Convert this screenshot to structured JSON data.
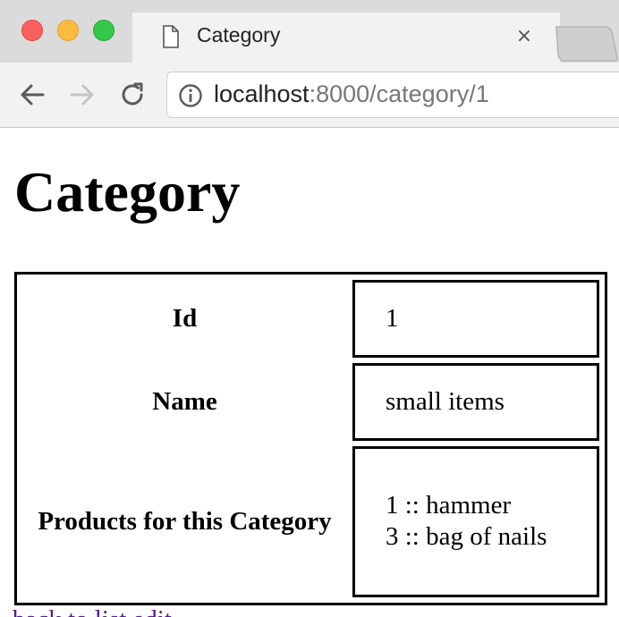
{
  "browser": {
    "tab_title": "Category",
    "url_host": "localhost",
    "url_rest": ":8000/category/1"
  },
  "page": {
    "heading": "Category",
    "rows": [
      {
        "label": "Id",
        "value": "1"
      },
      {
        "label": "Name",
        "value": "small items"
      },
      {
        "label": "Products for this Category",
        "products": [
          "1 :: hammer",
          "3 :: bag of nails"
        ]
      }
    ],
    "footer_link": "back to list edit"
  }
}
